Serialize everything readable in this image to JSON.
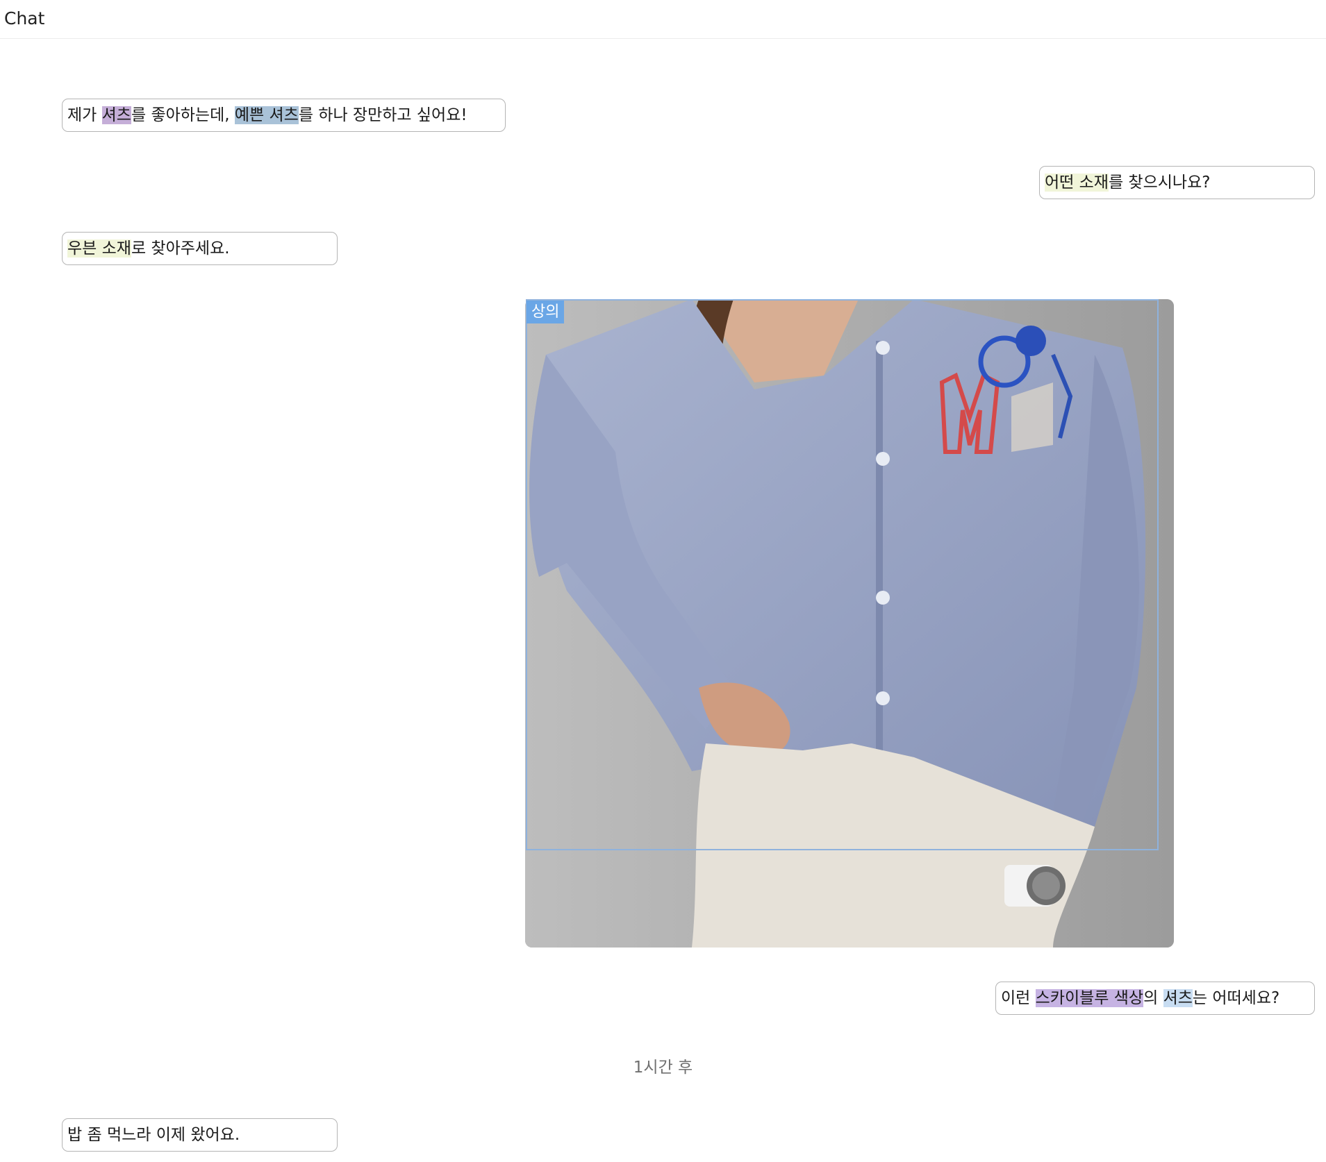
{
  "header": {
    "title": "Chat"
  },
  "messages": [
    {
      "side": "left",
      "parts": [
        {
          "text": "제가 "
        },
        {
          "text": "셔츠",
          "hl": "purple"
        },
        {
          "text": "를 좋아하는데, "
        },
        {
          "text": "예쁜 셔츠",
          "hl": "blue"
        },
        {
          "text": "를 하나 장만하고 싶어요!"
        }
      ]
    },
    {
      "side": "right",
      "parts": [
        {
          "text": "어떤 소재",
          "hl": "yellow"
        },
        {
          "text": "를 찾으시나요?"
        }
      ]
    },
    {
      "side": "left",
      "parts": [
        {
          "text": "우븐 소재",
          "hl": "yellow"
        },
        {
          "text": "로 찾아주세요."
        }
      ]
    },
    {
      "side": "right",
      "parts": [
        {
          "text": "이런 "
        },
        {
          "text": "스카이블루 색상",
          "hl": "violet"
        },
        {
          "text": "의 "
        },
        {
          "text": "셔츠",
          "hl": "sky"
        },
        {
          "text": "는 어떠세요?"
        }
      ]
    },
    {
      "side": "left",
      "parts": [
        {
          "text": "밥 좀 먹느라 이제 왔어요."
        }
      ]
    }
  ],
  "image": {
    "detection_label": "상의"
  },
  "divider": {
    "text": "1시간 후"
  }
}
